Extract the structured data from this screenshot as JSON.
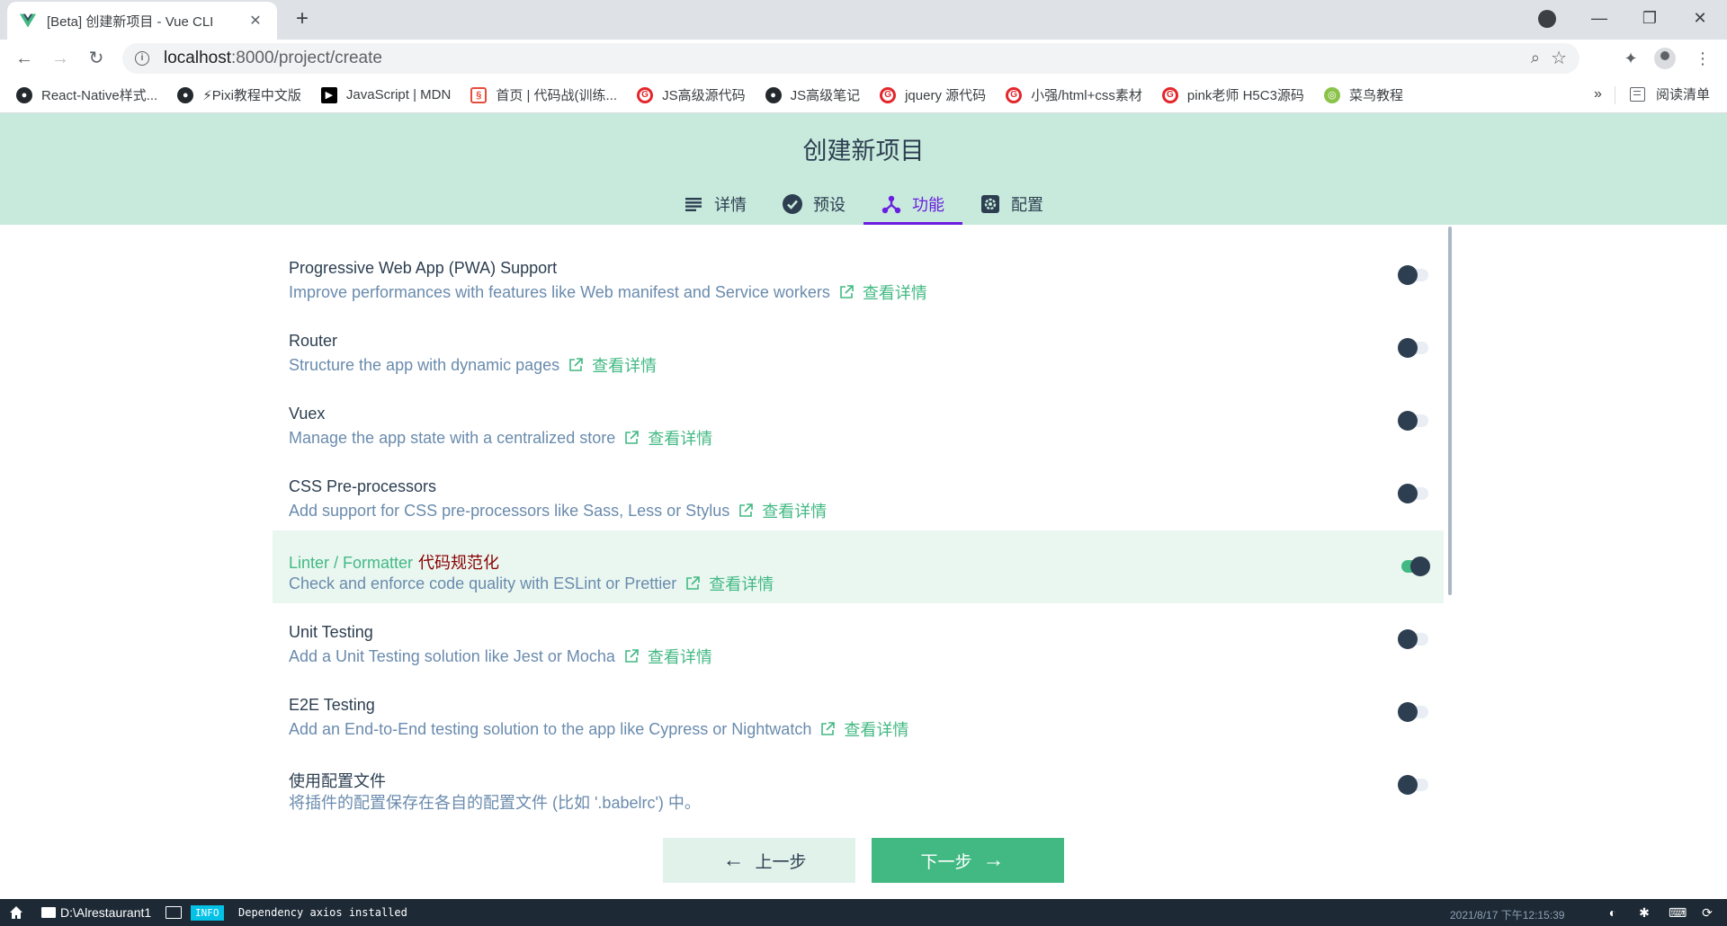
{
  "browser": {
    "tab_title": "[Beta] 创建新项目 - Vue CLI",
    "url_host": "localhost",
    "url_path": ":8000/project/create",
    "bookmarks": [
      {
        "label": "React-Native样式...",
        "icon": "github-icon"
      },
      {
        "label": "⚡Pixi教程中文版",
        "icon": "github-icon"
      },
      {
        "label": "JavaScript | MDN",
        "icon": "mdn-icon"
      },
      {
        "label": "首页 | 代码战(训练...",
        "icon": "codewars-icon"
      },
      {
        "label": "JS高级源代码",
        "icon": "gitee-icon"
      },
      {
        "label": "JS高级笔记",
        "icon": "github-icon"
      },
      {
        "label": "jquery 源代码",
        "icon": "gitee-icon"
      },
      {
        "label": "小强/html+css素材",
        "icon": "gitee-icon"
      },
      {
        "label": "pink老师 H5C3源码",
        "icon": "gitee-icon"
      },
      {
        "label": "菜鸟教程",
        "icon": "runoob-icon"
      }
    ],
    "bookmarks_more": "»",
    "reading_list": "阅读清单"
  },
  "header": {
    "title": "创建新项目",
    "steps": [
      {
        "label": "详情",
        "icon": "list-icon",
        "active": false
      },
      {
        "label": "预设",
        "icon": "check-circle-icon",
        "active": false
      },
      {
        "label": "功能",
        "icon": "fork-icon",
        "active": true
      },
      {
        "label": "配置",
        "icon": "settings-icon",
        "active": false
      }
    ]
  },
  "features": [
    {
      "name": "Progressive Web App (PWA) Support",
      "tag": "",
      "desc": "Improve performances with features like Web manifest and Service workers",
      "link": "查看详情",
      "enabled": false,
      "selected": false
    },
    {
      "name": "Router",
      "tag": "",
      "desc": "Structure the app with dynamic pages",
      "link": "查看详情",
      "enabled": false,
      "selected": false
    },
    {
      "name": "Vuex",
      "tag": "",
      "desc": "Manage the app state with a centralized store",
      "link": "查看详情",
      "enabled": false,
      "selected": false
    },
    {
      "name": "CSS Pre-processors",
      "tag": "",
      "desc": "Add support for CSS pre-processors like Sass, Less or Stylus",
      "link": "查看详情",
      "enabled": false,
      "selected": false
    },
    {
      "name": "Linter / Formatter",
      "tag": "代码规范化",
      "desc": "Check and enforce code quality with ESLint or Prettier",
      "link": "查看详情",
      "enabled": true,
      "selected": true
    },
    {
      "name": "Unit Testing",
      "tag": "",
      "desc": "Add a Unit Testing solution like Jest or Mocha",
      "link": "查看详情",
      "enabled": false,
      "selected": false
    },
    {
      "name": "E2E Testing",
      "tag": "",
      "desc": "Add an End-to-End testing solution to the app like Cypress or Nightwatch",
      "link": "查看详情",
      "enabled": false,
      "selected": false
    },
    {
      "name": "使用配置文件",
      "tag": "",
      "desc": "将插件的配置保存在各自的配置文件 (比如 '.babelrc') 中。",
      "link": "",
      "enabled": false,
      "selected": false
    }
  ],
  "footer": {
    "prev_label": "上一步",
    "next_label": "下一步"
  },
  "statusbar": {
    "path": "D:\\Alrestaurant1",
    "badge": "INFO",
    "message": "Dependency axios installed",
    "time": "2021/8/17 下午12:15:39"
  },
  "colors": {
    "accent": "#42b983",
    "header_bg": "#c8eadc",
    "active_step": "#6a1ee0",
    "statusbar_bg": "#1d2935"
  }
}
